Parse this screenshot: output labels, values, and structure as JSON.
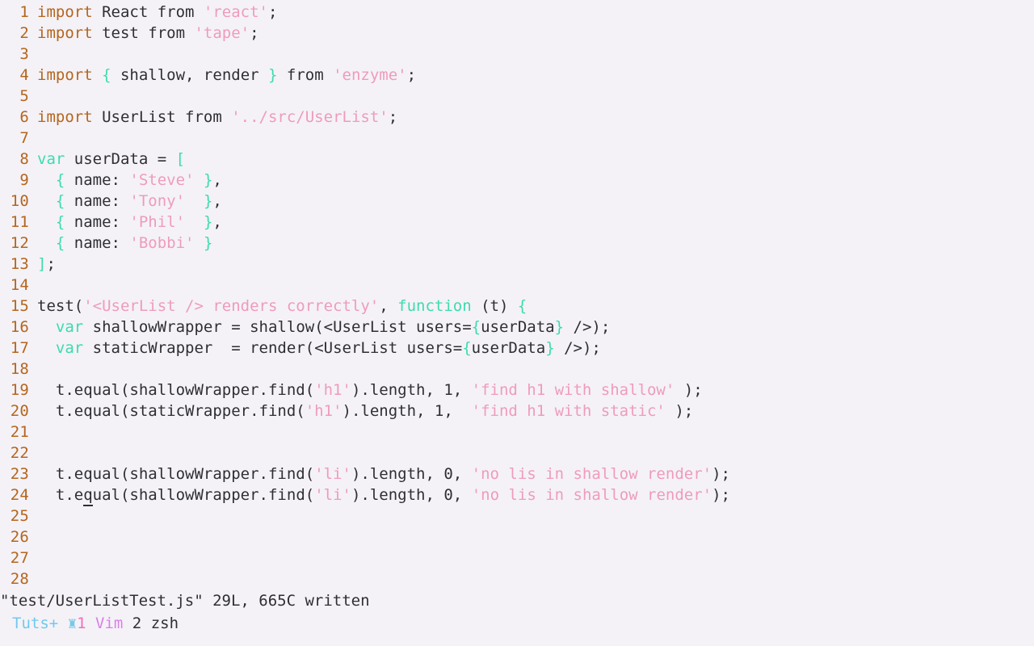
{
  "editor": {
    "app": "vim",
    "background": "#f4f2f7",
    "foreground": "#2f2f33",
    "colors": {
      "lineno": "#b5651d",
      "keyword": "#b5651d",
      "type": "#3ddbaf",
      "string": "#ef9bbc",
      "scrollbar": "#fdcbd8"
    },
    "cursor": {
      "line": 24,
      "column": 8,
      "char": "q"
    },
    "lines": [
      {
        "n": "1",
        "tokens": [
          {
            "t": "import",
            "c": "keyword"
          },
          {
            "t": " React from ",
            "c": "plain"
          },
          {
            "t": "'react'",
            "c": "string"
          },
          {
            "t": ";",
            "c": "plain"
          }
        ]
      },
      {
        "n": "2",
        "tokens": [
          {
            "t": "import",
            "c": "keyword"
          },
          {
            "t": " test from ",
            "c": "plain"
          },
          {
            "t": "'tape'",
            "c": "string"
          },
          {
            "t": ";",
            "c": "plain"
          }
        ]
      },
      {
        "n": "3",
        "tokens": []
      },
      {
        "n": "4",
        "tokens": [
          {
            "t": "import",
            "c": "keyword"
          },
          {
            "t": " ",
            "c": "plain"
          },
          {
            "t": "{",
            "c": "type"
          },
          {
            "t": " shallow, render ",
            "c": "plain"
          },
          {
            "t": "}",
            "c": "type"
          },
          {
            "t": " from ",
            "c": "plain"
          },
          {
            "t": "'enzyme'",
            "c": "string"
          },
          {
            "t": ";",
            "c": "plain"
          }
        ]
      },
      {
        "n": "5",
        "tokens": []
      },
      {
        "n": "6",
        "tokens": [
          {
            "t": "import",
            "c": "keyword"
          },
          {
            "t": " UserList from ",
            "c": "plain"
          },
          {
            "t": "'../src/UserList'",
            "c": "string"
          },
          {
            "t": ";",
            "c": "plain"
          }
        ]
      },
      {
        "n": "7",
        "tokens": []
      },
      {
        "n": "8",
        "tokens": [
          {
            "t": "var",
            "c": "type"
          },
          {
            "t": " userData = ",
            "c": "plain"
          },
          {
            "t": "[",
            "c": "type"
          }
        ]
      },
      {
        "n": "9",
        "tokens": [
          {
            "t": "  ",
            "c": "plain"
          },
          {
            "t": "{",
            "c": "type"
          },
          {
            "t": " name: ",
            "c": "plain"
          },
          {
            "t": "'Steve'",
            "c": "string"
          },
          {
            "t": " ",
            "c": "plain"
          },
          {
            "t": "}",
            "c": "type"
          },
          {
            "t": ",",
            "c": "plain"
          }
        ]
      },
      {
        "n": "10",
        "tokens": [
          {
            "t": "  ",
            "c": "plain"
          },
          {
            "t": "{",
            "c": "type"
          },
          {
            "t": " name: ",
            "c": "plain"
          },
          {
            "t": "'Tony'",
            "c": "string"
          },
          {
            "t": "  ",
            "c": "plain"
          },
          {
            "t": "}",
            "c": "type"
          },
          {
            "t": ",",
            "c": "plain"
          }
        ]
      },
      {
        "n": "11",
        "tokens": [
          {
            "t": "  ",
            "c": "plain"
          },
          {
            "t": "{",
            "c": "type"
          },
          {
            "t": " name: ",
            "c": "plain"
          },
          {
            "t": "'Phil'",
            "c": "string"
          },
          {
            "t": "  ",
            "c": "plain"
          },
          {
            "t": "}",
            "c": "type"
          },
          {
            "t": ",",
            "c": "plain"
          }
        ]
      },
      {
        "n": "12",
        "tokens": [
          {
            "t": "  ",
            "c": "plain"
          },
          {
            "t": "{",
            "c": "type"
          },
          {
            "t": " name: ",
            "c": "plain"
          },
          {
            "t": "'Bobbi'",
            "c": "string"
          },
          {
            "t": " ",
            "c": "plain"
          },
          {
            "t": "}",
            "c": "type"
          }
        ]
      },
      {
        "n": "13",
        "tokens": [
          {
            "t": "]",
            "c": "type"
          },
          {
            "t": ";",
            "c": "plain"
          }
        ]
      },
      {
        "n": "14",
        "tokens": []
      },
      {
        "n": "15",
        "tokens": [
          {
            "t": "test(",
            "c": "plain"
          },
          {
            "t": "'<UserList /> renders correctly'",
            "c": "string"
          },
          {
            "t": ", ",
            "c": "plain"
          },
          {
            "t": "function",
            "c": "type"
          },
          {
            "t": " (t) ",
            "c": "plain"
          },
          {
            "t": "{",
            "c": "type"
          }
        ]
      },
      {
        "n": "16",
        "tokens": [
          {
            "t": "  ",
            "c": "plain"
          },
          {
            "t": "var",
            "c": "type"
          },
          {
            "t": " shallowWrapper = shallow(<UserList users=",
            "c": "plain"
          },
          {
            "t": "{",
            "c": "type"
          },
          {
            "t": "userData",
            "c": "plain"
          },
          {
            "t": "}",
            "c": "type"
          },
          {
            "t": " />);",
            "c": "plain"
          }
        ]
      },
      {
        "n": "17",
        "tokens": [
          {
            "t": "  ",
            "c": "plain"
          },
          {
            "t": "var",
            "c": "type"
          },
          {
            "t": " staticWrapper  = render(<UserList users=",
            "c": "plain"
          },
          {
            "t": "{",
            "c": "type"
          },
          {
            "t": "userData",
            "c": "plain"
          },
          {
            "t": "}",
            "c": "type"
          },
          {
            "t": " />);",
            "c": "plain"
          }
        ]
      },
      {
        "n": "18",
        "tokens": []
      },
      {
        "n": "19",
        "tokens": [
          {
            "t": "  t.equal(shallowWrapper.find(",
            "c": "plain"
          },
          {
            "t": "'h1'",
            "c": "string"
          },
          {
            "t": ").length, 1, ",
            "c": "plain"
          },
          {
            "t": "'find h1 with shallow'",
            "c": "string"
          },
          {
            "t": " );",
            "c": "plain"
          }
        ]
      },
      {
        "n": "20",
        "tokens": [
          {
            "t": "  t.equal(staticWrapper.find(",
            "c": "plain"
          },
          {
            "t": "'h1'",
            "c": "string"
          },
          {
            "t": ").length, 1,  ",
            "c": "plain"
          },
          {
            "t": "'find h1 with static'",
            "c": "string"
          },
          {
            "t": " );",
            "c": "plain"
          }
        ]
      },
      {
        "n": "21",
        "tokens": []
      },
      {
        "n": "22",
        "tokens": []
      },
      {
        "n": "23",
        "tokens": [
          {
            "t": "  t.equal(shallowWrapper.find(",
            "c": "plain"
          },
          {
            "t": "'li'",
            "c": "string"
          },
          {
            "t": ").length, 0, ",
            "c": "plain"
          },
          {
            "t": "'no lis in shallow render'",
            "c": "string"
          },
          {
            "t": ");",
            "c": "plain"
          }
        ]
      },
      {
        "n": "24",
        "tokens": [
          {
            "t": "  t.e",
            "c": "plain"
          },
          {
            "t": "q",
            "c": "plain",
            "cursor": true
          },
          {
            "t": "ual(shallowWrapper.find(",
            "c": "plain"
          },
          {
            "t": "'li'",
            "c": "string"
          },
          {
            "t": ").length, 0, ",
            "c": "plain"
          },
          {
            "t": "'no lis in shallow render'",
            "c": "string"
          },
          {
            "t": ");",
            "c": "plain"
          }
        ]
      },
      {
        "n": "25",
        "tokens": []
      },
      {
        "n": "26",
        "tokens": []
      },
      {
        "n": "27",
        "tokens": []
      },
      {
        "n": "28",
        "tokens": []
      }
    ]
  },
  "message_line": {
    "text": "\"test/UserListTest.js\" 29L, 665C written",
    "filename": "test/UserListTest.js",
    "line_count": "29L",
    "char_count": "665C",
    "action": "written"
  },
  "tmux_bar": {
    "session": "Tuts+",
    "rook_icon": "♜",
    "windows": [
      {
        "index": "1",
        "name": "Vim",
        "active": true
      },
      {
        "index": "2",
        "name": "zsh",
        "active": false
      }
    ],
    "window1_index": "1",
    "window1_name": "Vim",
    "window2_index": "2",
    "window2_name": "zsh"
  }
}
